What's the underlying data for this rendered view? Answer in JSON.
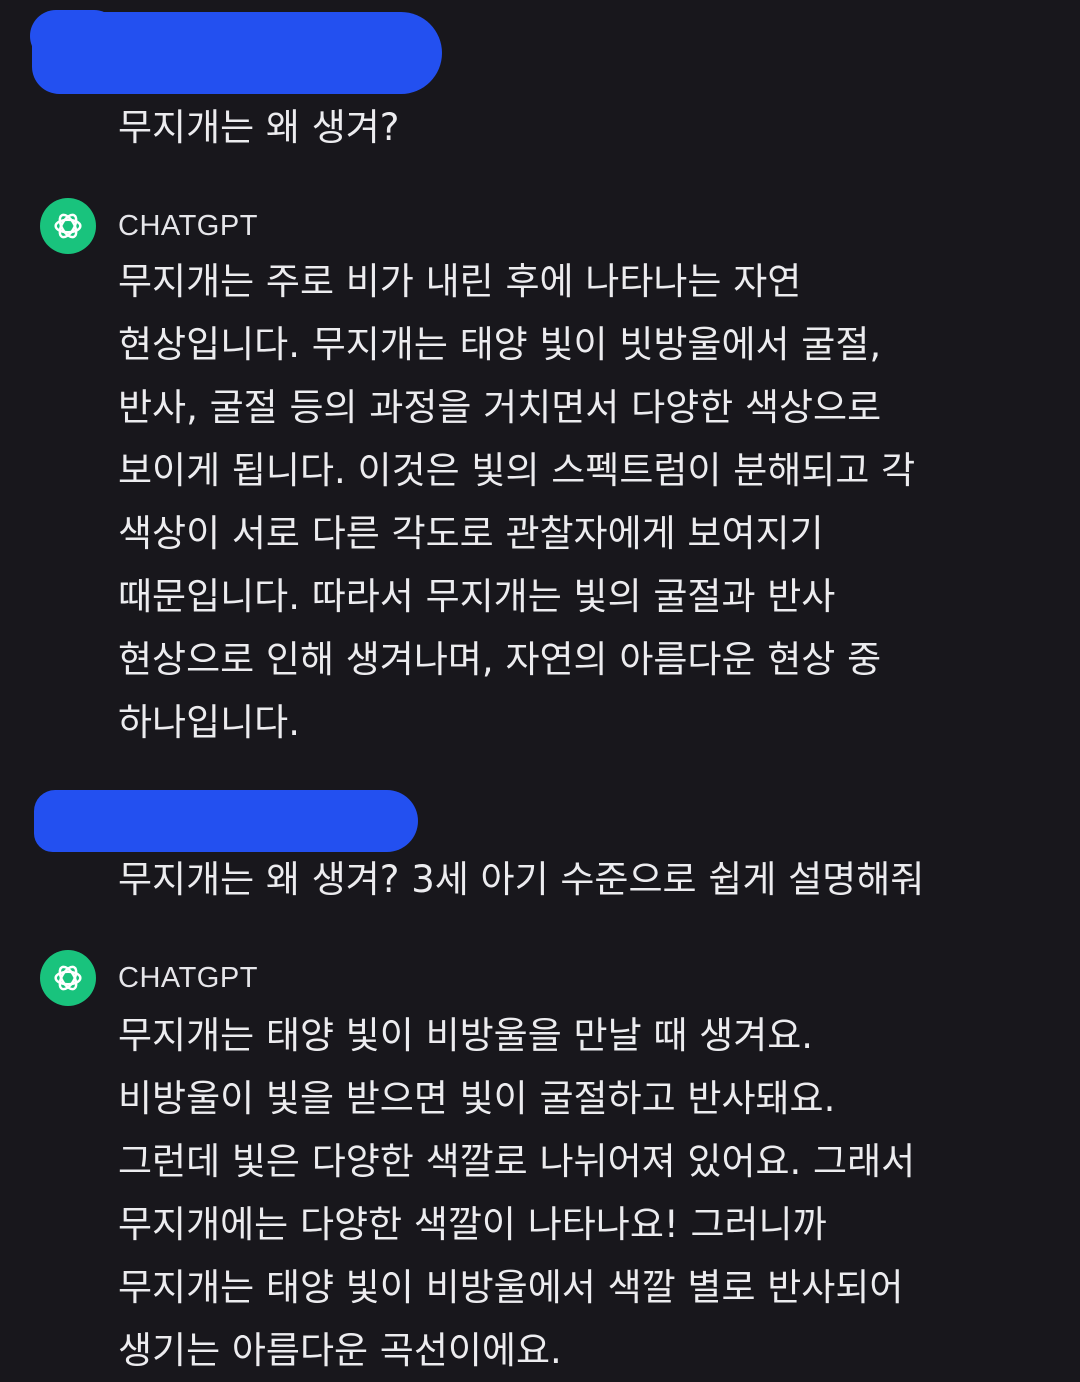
{
  "conversation": {
    "turns": [
      {
        "role": "user",
        "text": "무지개는 왜 생겨?"
      },
      {
        "role": "assistant",
        "name": "CHATGPT",
        "lines": [
          "무지개는 주로 비가 내린 후에 나타나는 자연",
          "현상입니다. 무지개는 태양 빛이 빗방울에서 굴절,",
          "반사, 굴절 등의 과정을 거치면서 다양한 색상으로",
          "보이게 됩니다. 이것은 빛의 스펙트럼이 분해되고 각",
          "색상이 서로 다른 각도로 관찰자에게 보여지기",
          "때문입니다. 따라서 무지개는 빛의 굴절과 반사",
          "현상으로 인해 생겨나며, 자연의 아름다운 현상 중",
          "하나입니다."
        ]
      },
      {
        "role": "user",
        "text": "무지개는 왜 생겨? 3세 아기 수준으로 쉽게 설명해줘"
      },
      {
        "role": "assistant",
        "name": "CHATGPT",
        "lines": [
          "무지개는 태양 빛이 비방울을 만날 때 생겨요.",
          "비방울이 빛을 받으면 빛이 굴절하고 반사돼요.",
          "그런데 빛은 다양한 색깔로 나뉘어져 있어요. 그래서",
          "무지개에는 다양한 색깔이 나타나요! 그러니까",
          "무지개는 태양 빛이 비방울에서 색깔 별로 반사되어",
          "생기는 아름다운 곡선이에요."
        ]
      }
    ]
  },
  "icons": {
    "assistant_avatar": "openai-logo-icon"
  },
  "colors": {
    "background": "#18171c",
    "text": "#ececef",
    "avatar": "#19c37d",
    "redaction": "#2350f0"
  }
}
